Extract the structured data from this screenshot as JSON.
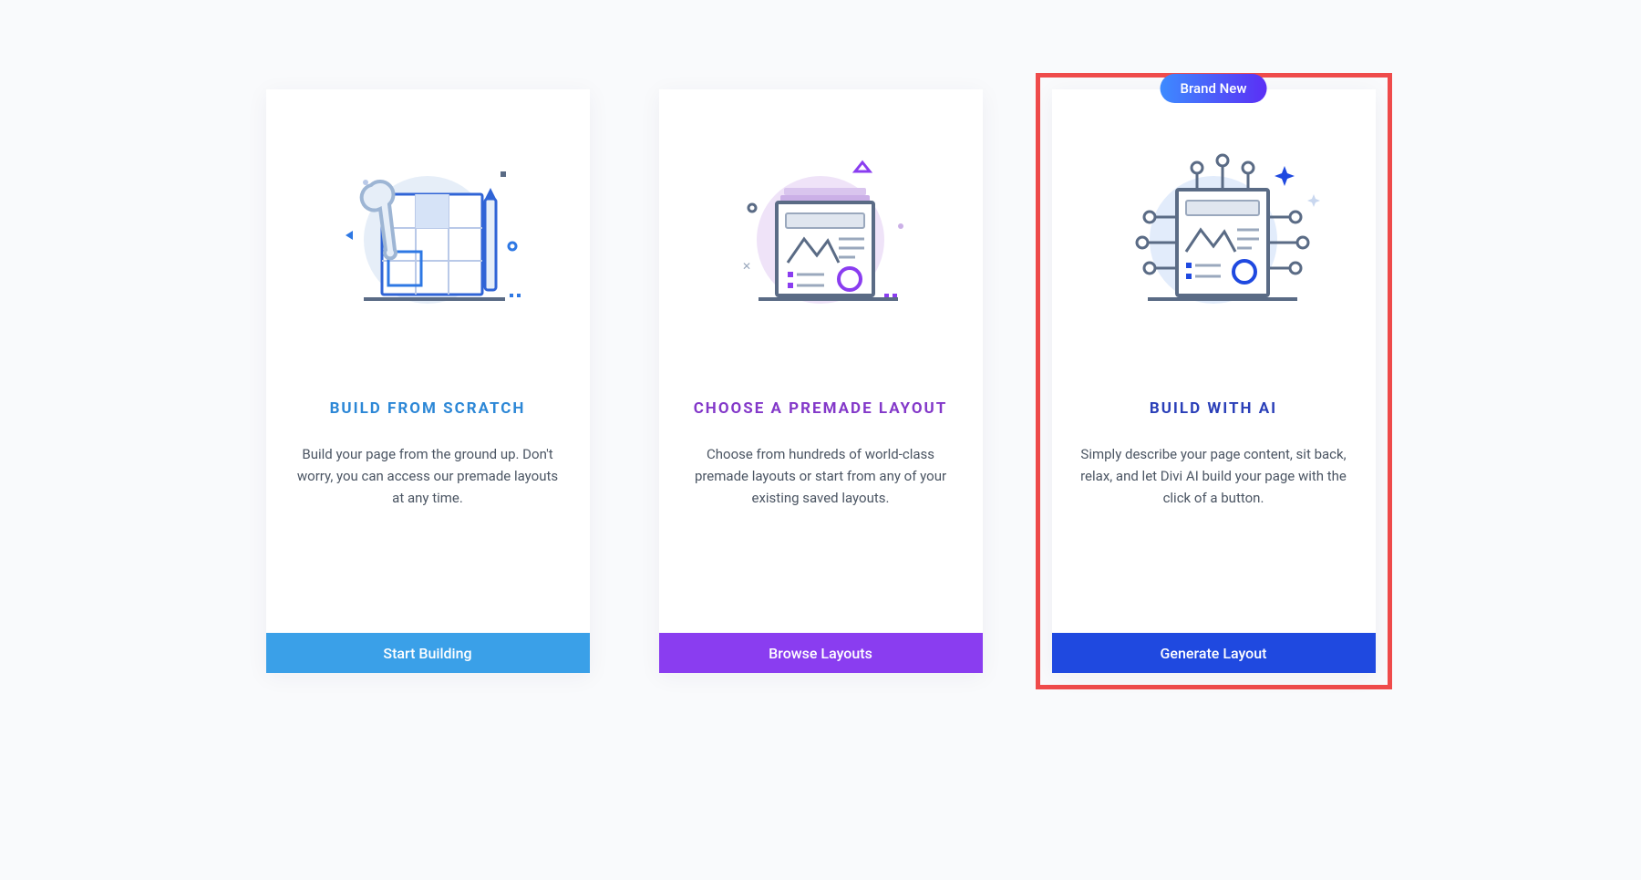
{
  "cards": [
    {
      "title": "Build From Scratch",
      "description": "Build your page from the ground up. Don't worry, you can access our premade layouts at any time.",
      "button": "Start Building",
      "badge": null
    },
    {
      "title": "Choose A Premade Layout",
      "description": "Choose from hundreds of world-class premade layouts or start from any of your existing saved layouts.",
      "button": "Browse Layouts",
      "badge": null
    },
    {
      "title": "Build With AI",
      "description": "Simply describe your page content, sit back, relax, and let Divi AI build your page with the click of a button.",
      "button": "Generate Layout",
      "badge": "Brand New"
    }
  ],
  "colors": {
    "card1_title": "#2c87d6",
    "card2_title": "#8338c9",
    "card3_title": "#2a3fb8",
    "card1_button": "#3aa0e8",
    "card2_button": "#8a3df0",
    "card3_button": "#1f49e0",
    "highlight_border": "#ef4b4b"
  }
}
